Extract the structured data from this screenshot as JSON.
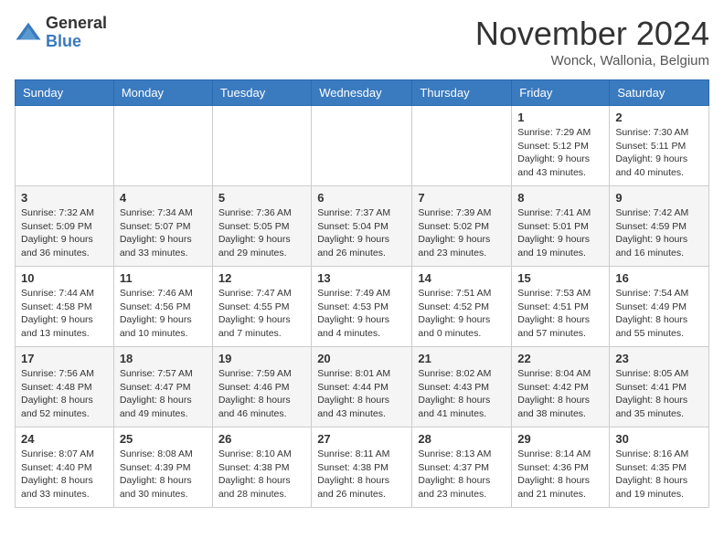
{
  "header": {
    "logo_general": "General",
    "logo_blue": "Blue",
    "month_title": "November 2024",
    "location": "Wonck, Wallonia, Belgium"
  },
  "calendar": {
    "headers": [
      "Sunday",
      "Monday",
      "Tuesday",
      "Wednesday",
      "Thursday",
      "Friday",
      "Saturday"
    ],
    "weeks": [
      [
        {
          "day": "",
          "info": ""
        },
        {
          "day": "",
          "info": ""
        },
        {
          "day": "",
          "info": ""
        },
        {
          "day": "",
          "info": ""
        },
        {
          "day": "",
          "info": ""
        },
        {
          "day": "1",
          "info": "Sunrise: 7:29 AM\nSunset: 5:12 PM\nDaylight: 9 hours and 43 minutes."
        },
        {
          "day": "2",
          "info": "Sunrise: 7:30 AM\nSunset: 5:11 PM\nDaylight: 9 hours and 40 minutes."
        }
      ],
      [
        {
          "day": "3",
          "info": "Sunrise: 7:32 AM\nSunset: 5:09 PM\nDaylight: 9 hours and 36 minutes."
        },
        {
          "day": "4",
          "info": "Sunrise: 7:34 AM\nSunset: 5:07 PM\nDaylight: 9 hours and 33 minutes."
        },
        {
          "day": "5",
          "info": "Sunrise: 7:36 AM\nSunset: 5:05 PM\nDaylight: 9 hours and 29 minutes."
        },
        {
          "day": "6",
          "info": "Sunrise: 7:37 AM\nSunset: 5:04 PM\nDaylight: 9 hours and 26 minutes."
        },
        {
          "day": "7",
          "info": "Sunrise: 7:39 AM\nSunset: 5:02 PM\nDaylight: 9 hours and 23 minutes."
        },
        {
          "day": "8",
          "info": "Sunrise: 7:41 AM\nSunset: 5:01 PM\nDaylight: 9 hours and 19 minutes."
        },
        {
          "day": "9",
          "info": "Sunrise: 7:42 AM\nSunset: 4:59 PM\nDaylight: 9 hours and 16 minutes."
        }
      ],
      [
        {
          "day": "10",
          "info": "Sunrise: 7:44 AM\nSunset: 4:58 PM\nDaylight: 9 hours and 13 minutes."
        },
        {
          "day": "11",
          "info": "Sunrise: 7:46 AM\nSunset: 4:56 PM\nDaylight: 9 hours and 10 minutes."
        },
        {
          "day": "12",
          "info": "Sunrise: 7:47 AM\nSunset: 4:55 PM\nDaylight: 9 hours and 7 minutes."
        },
        {
          "day": "13",
          "info": "Sunrise: 7:49 AM\nSunset: 4:53 PM\nDaylight: 9 hours and 4 minutes."
        },
        {
          "day": "14",
          "info": "Sunrise: 7:51 AM\nSunset: 4:52 PM\nDaylight: 9 hours and 0 minutes."
        },
        {
          "day": "15",
          "info": "Sunrise: 7:53 AM\nSunset: 4:51 PM\nDaylight: 8 hours and 57 minutes."
        },
        {
          "day": "16",
          "info": "Sunrise: 7:54 AM\nSunset: 4:49 PM\nDaylight: 8 hours and 55 minutes."
        }
      ],
      [
        {
          "day": "17",
          "info": "Sunrise: 7:56 AM\nSunset: 4:48 PM\nDaylight: 8 hours and 52 minutes."
        },
        {
          "day": "18",
          "info": "Sunrise: 7:57 AM\nSunset: 4:47 PM\nDaylight: 8 hours and 49 minutes."
        },
        {
          "day": "19",
          "info": "Sunrise: 7:59 AM\nSunset: 4:46 PM\nDaylight: 8 hours and 46 minutes."
        },
        {
          "day": "20",
          "info": "Sunrise: 8:01 AM\nSunset: 4:44 PM\nDaylight: 8 hours and 43 minutes."
        },
        {
          "day": "21",
          "info": "Sunrise: 8:02 AM\nSunset: 4:43 PM\nDaylight: 8 hours and 41 minutes."
        },
        {
          "day": "22",
          "info": "Sunrise: 8:04 AM\nSunset: 4:42 PM\nDaylight: 8 hours and 38 minutes."
        },
        {
          "day": "23",
          "info": "Sunrise: 8:05 AM\nSunset: 4:41 PM\nDaylight: 8 hours and 35 minutes."
        }
      ],
      [
        {
          "day": "24",
          "info": "Sunrise: 8:07 AM\nSunset: 4:40 PM\nDaylight: 8 hours and 33 minutes."
        },
        {
          "day": "25",
          "info": "Sunrise: 8:08 AM\nSunset: 4:39 PM\nDaylight: 8 hours and 30 minutes."
        },
        {
          "day": "26",
          "info": "Sunrise: 8:10 AM\nSunset: 4:38 PM\nDaylight: 8 hours and 28 minutes."
        },
        {
          "day": "27",
          "info": "Sunrise: 8:11 AM\nSunset: 4:38 PM\nDaylight: 8 hours and 26 minutes."
        },
        {
          "day": "28",
          "info": "Sunrise: 8:13 AM\nSunset: 4:37 PM\nDaylight: 8 hours and 23 minutes."
        },
        {
          "day": "29",
          "info": "Sunrise: 8:14 AM\nSunset: 4:36 PM\nDaylight: 8 hours and 21 minutes."
        },
        {
          "day": "30",
          "info": "Sunrise: 8:16 AM\nSunset: 4:35 PM\nDaylight: 8 hours and 19 minutes."
        }
      ]
    ]
  }
}
